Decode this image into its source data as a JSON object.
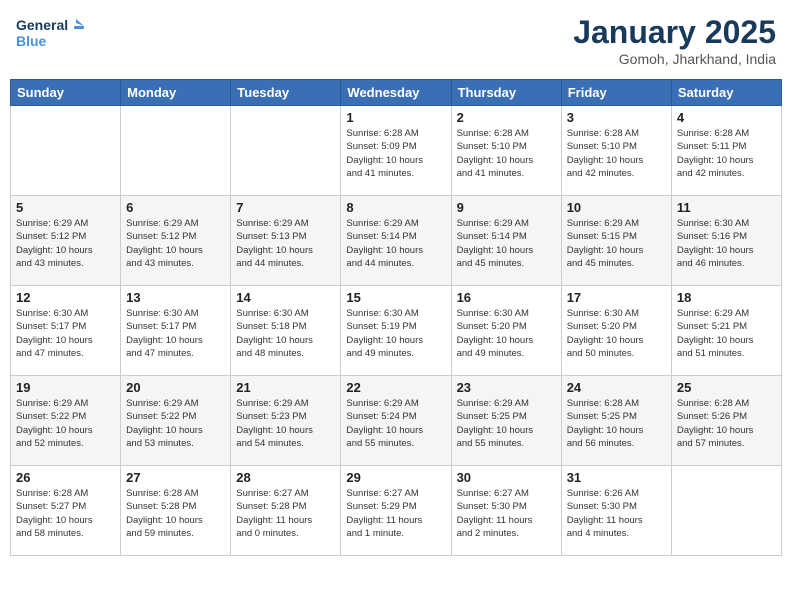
{
  "header": {
    "logo_general": "General",
    "logo_blue": "Blue",
    "month": "January 2025",
    "location": "Gomoh, Jharkhand, India"
  },
  "weekdays": [
    "Sunday",
    "Monday",
    "Tuesday",
    "Wednesday",
    "Thursday",
    "Friday",
    "Saturday"
  ],
  "weeks": [
    [
      {
        "day": "",
        "info": ""
      },
      {
        "day": "",
        "info": ""
      },
      {
        "day": "",
        "info": ""
      },
      {
        "day": "1",
        "info": "Sunrise: 6:28 AM\nSunset: 5:09 PM\nDaylight: 10 hours\nand 41 minutes."
      },
      {
        "day": "2",
        "info": "Sunrise: 6:28 AM\nSunset: 5:10 PM\nDaylight: 10 hours\nand 41 minutes."
      },
      {
        "day": "3",
        "info": "Sunrise: 6:28 AM\nSunset: 5:10 PM\nDaylight: 10 hours\nand 42 minutes."
      },
      {
        "day": "4",
        "info": "Sunrise: 6:28 AM\nSunset: 5:11 PM\nDaylight: 10 hours\nand 42 minutes."
      }
    ],
    [
      {
        "day": "5",
        "info": "Sunrise: 6:29 AM\nSunset: 5:12 PM\nDaylight: 10 hours\nand 43 minutes."
      },
      {
        "day": "6",
        "info": "Sunrise: 6:29 AM\nSunset: 5:12 PM\nDaylight: 10 hours\nand 43 minutes."
      },
      {
        "day": "7",
        "info": "Sunrise: 6:29 AM\nSunset: 5:13 PM\nDaylight: 10 hours\nand 44 minutes."
      },
      {
        "day": "8",
        "info": "Sunrise: 6:29 AM\nSunset: 5:14 PM\nDaylight: 10 hours\nand 44 minutes."
      },
      {
        "day": "9",
        "info": "Sunrise: 6:29 AM\nSunset: 5:14 PM\nDaylight: 10 hours\nand 45 minutes."
      },
      {
        "day": "10",
        "info": "Sunrise: 6:29 AM\nSunset: 5:15 PM\nDaylight: 10 hours\nand 45 minutes."
      },
      {
        "day": "11",
        "info": "Sunrise: 6:30 AM\nSunset: 5:16 PM\nDaylight: 10 hours\nand 46 minutes."
      }
    ],
    [
      {
        "day": "12",
        "info": "Sunrise: 6:30 AM\nSunset: 5:17 PM\nDaylight: 10 hours\nand 47 minutes."
      },
      {
        "day": "13",
        "info": "Sunrise: 6:30 AM\nSunset: 5:17 PM\nDaylight: 10 hours\nand 47 minutes."
      },
      {
        "day": "14",
        "info": "Sunrise: 6:30 AM\nSunset: 5:18 PM\nDaylight: 10 hours\nand 48 minutes."
      },
      {
        "day": "15",
        "info": "Sunrise: 6:30 AM\nSunset: 5:19 PM\nDaylight: 10 hours\nand 49 minutes."
      },
      {
        "day": "16",
        "info": "Sunrise: 6:30 AM\nSunset: 5:20 PM\nDaylight: 10 hours\nand 49 minutes."
      },
      {
        "day": "17",
        "info": "Sunrise: 6:30 AM\nSunset: 5:20 PM\nDaylight: 10 hours\nand 50 minutes."
      },
      {
        "day": "18",
        "info": "Sunrise: 6:29 AM\nSunset: 5:21 PM\nDaylight: 10 hours\nand 51 minutes."
      }
    ],
    [
      {
        "day": "19",
        "info": "Sunrise: 6:29 AM\nSunset: 5:22 PM\nDaylight: 10 hours\nand 52 minutes."
      },
      {
        "day": "20",
        "info": "Sunrise: 6:29 AM\nSunset: 5:22 PM\nDaylight: 10 hours\nand 53 minutes."
      },
      {
        "day": "21",
        "info": "Sunrise: 6:29 AM\nSunset: 5:23 PM\nDaylight: 10 hours\nand 54 minutes."
      },
      {
        "day": "22",
        "info": "Sunrise: 6:29 AM\nSunset: 5:24 PM\nDaylight: 10 hours\nand 55 minutes."
      },
      {
        "day": "23",
        "info": "Sunrise: 6:29 AM\nSunset: 5:25 PM\nDaylight: 10 hours\nand 55 minutes."
      },
      {
        "day": "24",
        "info": "Sunrise: 6:28 AM\nSunset: 5:25 PM\nDaylight: 10 hours\nand 56 minutes."
      },
      {
        "day": "25",
        "info": "Sunrise: 6:28 AM\nSunset: 5:26 PM\nDaylight: 10 hours\nand 57 minutes."
      }
    ],
    [
      {
        "day": "26",
        "info": "Sunrise: 6:28 AM\nSunset: 5:27 PM\nDaylight: 10 hours\nand 58 minutes."
      },
      {
        "day": "27",
        "info": "Sunrise: 6:28 AM\nSunset: 5:28 PM\nDaylight: 10 hours\nand 59 minutes."
      },
      {
        "day": "28",
        "info": "Sunrise: 6:27 AM\nSunset: 5:28 PM\nDaylight: 11 hours\nand 0 minutes."
      },
      {
        "day": "29",
        "info": "Sunrise: 6:27 AM\nSunset: 5:29 PM\nDaylight: 11 hours\nand 1 minute."
      },
      {
        "day": "30",
        "info": "Sunrise: 6:27 AM\nSunset: 5:30 PM\nDaylight: 11 hours\nand 2 minutes."
      },
      {
        "day": "31",
        "info": "Sunrise: 6:26 AM\nSunset: 5:30 PM\nDaylight: 11 hours\nand 4 minutes."
      },
      {
        "day": "",
        "info": ""
      }
    ]
  ]
}
